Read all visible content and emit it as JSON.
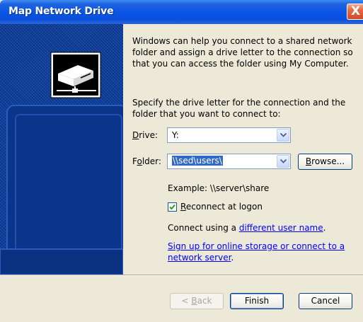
{
  "window": {
    "title": "Map Network Drive",
    "close_glyph": "X"
  },
  "intro_text": "Windows can help you connect to a shared network folder and assign a drive letter to the connection so that you can access the folder using My Computer.",
  "specify_text": "Specify the drive letter for the connection and the folder that you want to connect to:",
  "drive": {
    "label_prefix": "",
    "label_accel": "D",
    "label_rest": "rive:",
    "value": "Y:"
  },
  "folder": {
    "label_prefix": "F",
    "label_accel": "o",
    "label_rest": "lder:",
    "value": "\\\\sed\\users\\"
  },
  "browse_button": {
    "prefix": "",
    "accel": "B",
    "rest": "rowse..."
  },
  "example_text": "Example: \\\\server\\share",
  "reconnect": {
    "checked": true,
    "accel": "R",
    "rest": "econnect at logon"
  },
  "connect_using": {
    "prefix": "Connect using a ",
    "link": "different user name",
    "suffix": "."
  },
  "signup_link": {
    "line1": "Sign up for online storage or connect to a",
    "line2": "network server"
  },
  "signup_suffix": ".",
  "buttons": {
    "back_prefix": "< ",
    "back_accel": "B",
    "back_rest": "ack",
    "finish": "Finish",
    "cancel": "Cancel"
  },
  "icons": {
    "close": "close-icon",
    "computer": "network-computer-icon",
    "dropdown": "chevron-down-icon",
    "checkmark": "checkmark-icon"
  },
  "colors": {
    "titlebar": "#0a55e6",
    "side_panel": "#0b3d9c",
    "link": "#0000ff",
    "selection": "#316ac5",
    "dialog_bg": "#ece9d8"
  }
}
